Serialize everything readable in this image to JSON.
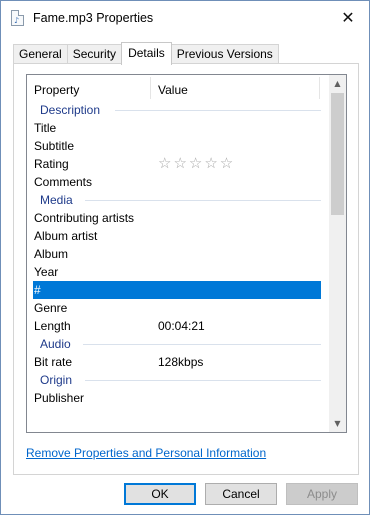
{
  "window": {
    "title": "Fame.mp3 Properties",
    "icon": "audio-file-icon",
    "icon_glyph": "♪",
    "close_glyph": "✕"
  },
  "tabs": [
    {
      "label": "General",
      "active": false
    },
    {
      "label": "Security",
      "active": false
    },
    {
      "label": "Details",
      "active": true
    },
    {
      "label": "Previous Versions",
      "active": false
    }
  ],
  "list": {
    "columns": {
      "property": "Property",
      "value": "Value"
    },
    "groups": {
      "description": "Description",
      "media": "Media",
      "audio": "Audio",
      "origin": "Origin"
    },
    "rows": {
      "title": {
        "property": "Title",
        "value": ""
      },
      "subtitle": {
        "property": "Subtitle",
        "value": ""
      },
      "rating": {
        "property": "Rating",
        "value": "☆☆☆☆☆"
      },
      "comments": {
        "property": "Comments",
        "value": ""
      },
      "contributing_artists": {
        "property": "Contributing artists",
        "value": ""
      },
      "album_artist": {
        "property": "Album artist",
        "value": ""
      },
      "album": {
        "property": "Album",
        "value": ""
      },
      "year": {
        "property": "Year",
        "value": ""
      },
      "track": {
        "property": "#",
        "value": "",
        "selected": true
      },
      "genre": {
        "property": "Genre",
        "value": ""
      },
      "length": {
        "property": "Length",
        "value": "00:04:21"
      },
      "bit_rate": {
        "property": "Bit rate",
        "value": "128kbps"
      },
      "publisher": {
        "property": "Publisher",
        "value": ""
      }
    }
  },
  "scrollbar": {
    "up_glyph": "▲",
    "down_glyph": "▼"
  },
  "remove_link": "Remove Properties and Personal Information",
  "buttons": {
    "ok": "OK",
    "cancel": "Cancel",
    "apply": "Apply"
  },
  "colors": {
    "selection": "#0078d7",
    "link": "#0066cc",
    "group_heading": "#1e3a8a"
  }
}
